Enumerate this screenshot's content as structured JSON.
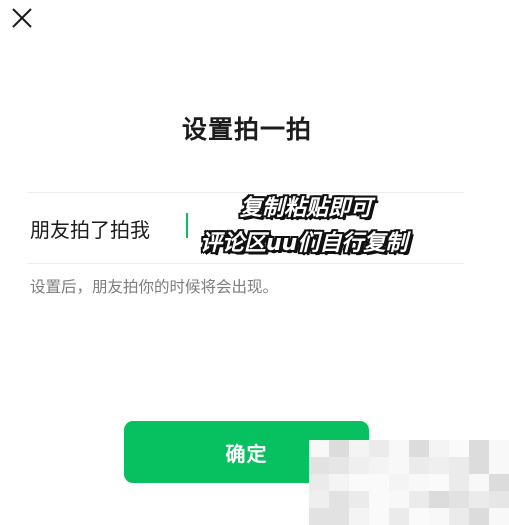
{
  "header": {
    "close_icon": "close-icon"
  },
  "page": {
    "title": "设置拍一拍"
  },
  "form": {
    "row_label": "朋友拍了拍我",
    "input_value": "",
    "hint": "设置后，朋友拍你的时候将会出现。"
  },
  "overlay": {
    "line1": "复制粘贴即可",
    "line2": "评论区uu们自行复制"
  },
  "actions": {
    "confirm_label": "确定"
  },
  "colors": {
    "accent": "#07c160",
    "text": "#1c1c1c",
    "hint": "#7d7d7d",
    "divider": "#ececec"
  }
}
